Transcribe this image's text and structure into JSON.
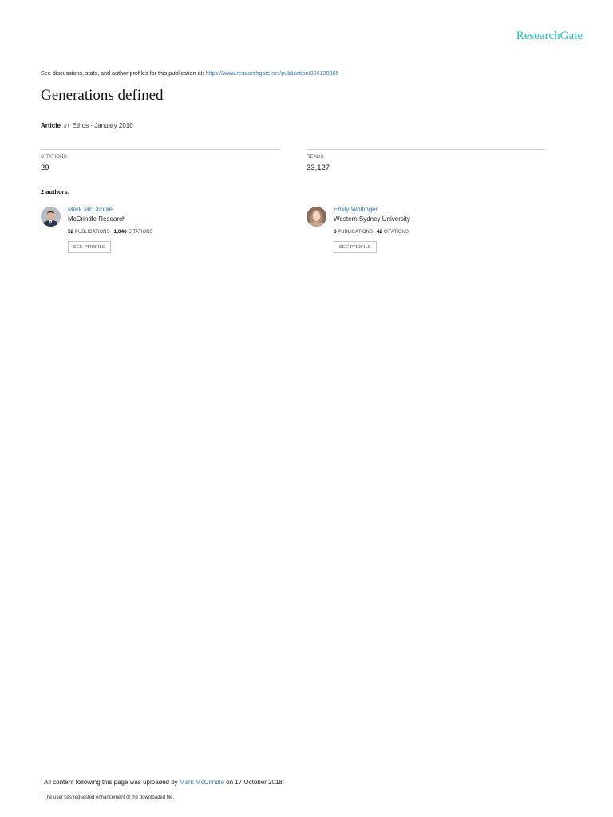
{
  "header": {
    "logo_text": "ResearchGate",
    "accent_color": "#19c5b1"
  },
  "discussion": {
    "prefix": "See discussions, stats, and author profiles for this publication at:",
    "url": "https://www.researchgate.net/publication/306139905"
  },
  "publication": {
    "title": "Generations defined",
    "type": "Article",
    "in_word": "in",
    "journal": "Ethos",
    "date": "· January 2010"
  },
  "stats": {
    "citations_label": "CITATIONS",
    "citations_value": "29",
    "reads_label": "READS",
    "reads_value": "33,127"
  },
  "authors_heading": "2 authors:",
  "authors": [
    {
      "name": "Mark McCrindle",
      "institution": "McCrindle Research",
      "publications_count": "52",
      "publications_label": "PUBLICATIONS",
      "citations_count": "1,046",
      "citations_label": "CITATIONS",
      "button_label": "SEE PROFILE"
    },
    {
      "name": "Emily Wolfinger",
      "institution": "Western Sydney University",
      "publications_count": "6",
      "publications_label": "PUBLICATIONS",
      "citations_count": "42",
      "citations_label": "CITATIONS",
      "button_label": "SEE PROFILE"
    }
  ],
  "footer": {
    "upload_prefix": "All content following this page was uploaded by",
    "uploader": "Mark McCrindle",
    "upload_suffix": "on 17 October 2018.",
    "enhancement_note": "The user has requested enhancement of the downloaded file."
  },
  "link_color": "#3d7ab8"
}
